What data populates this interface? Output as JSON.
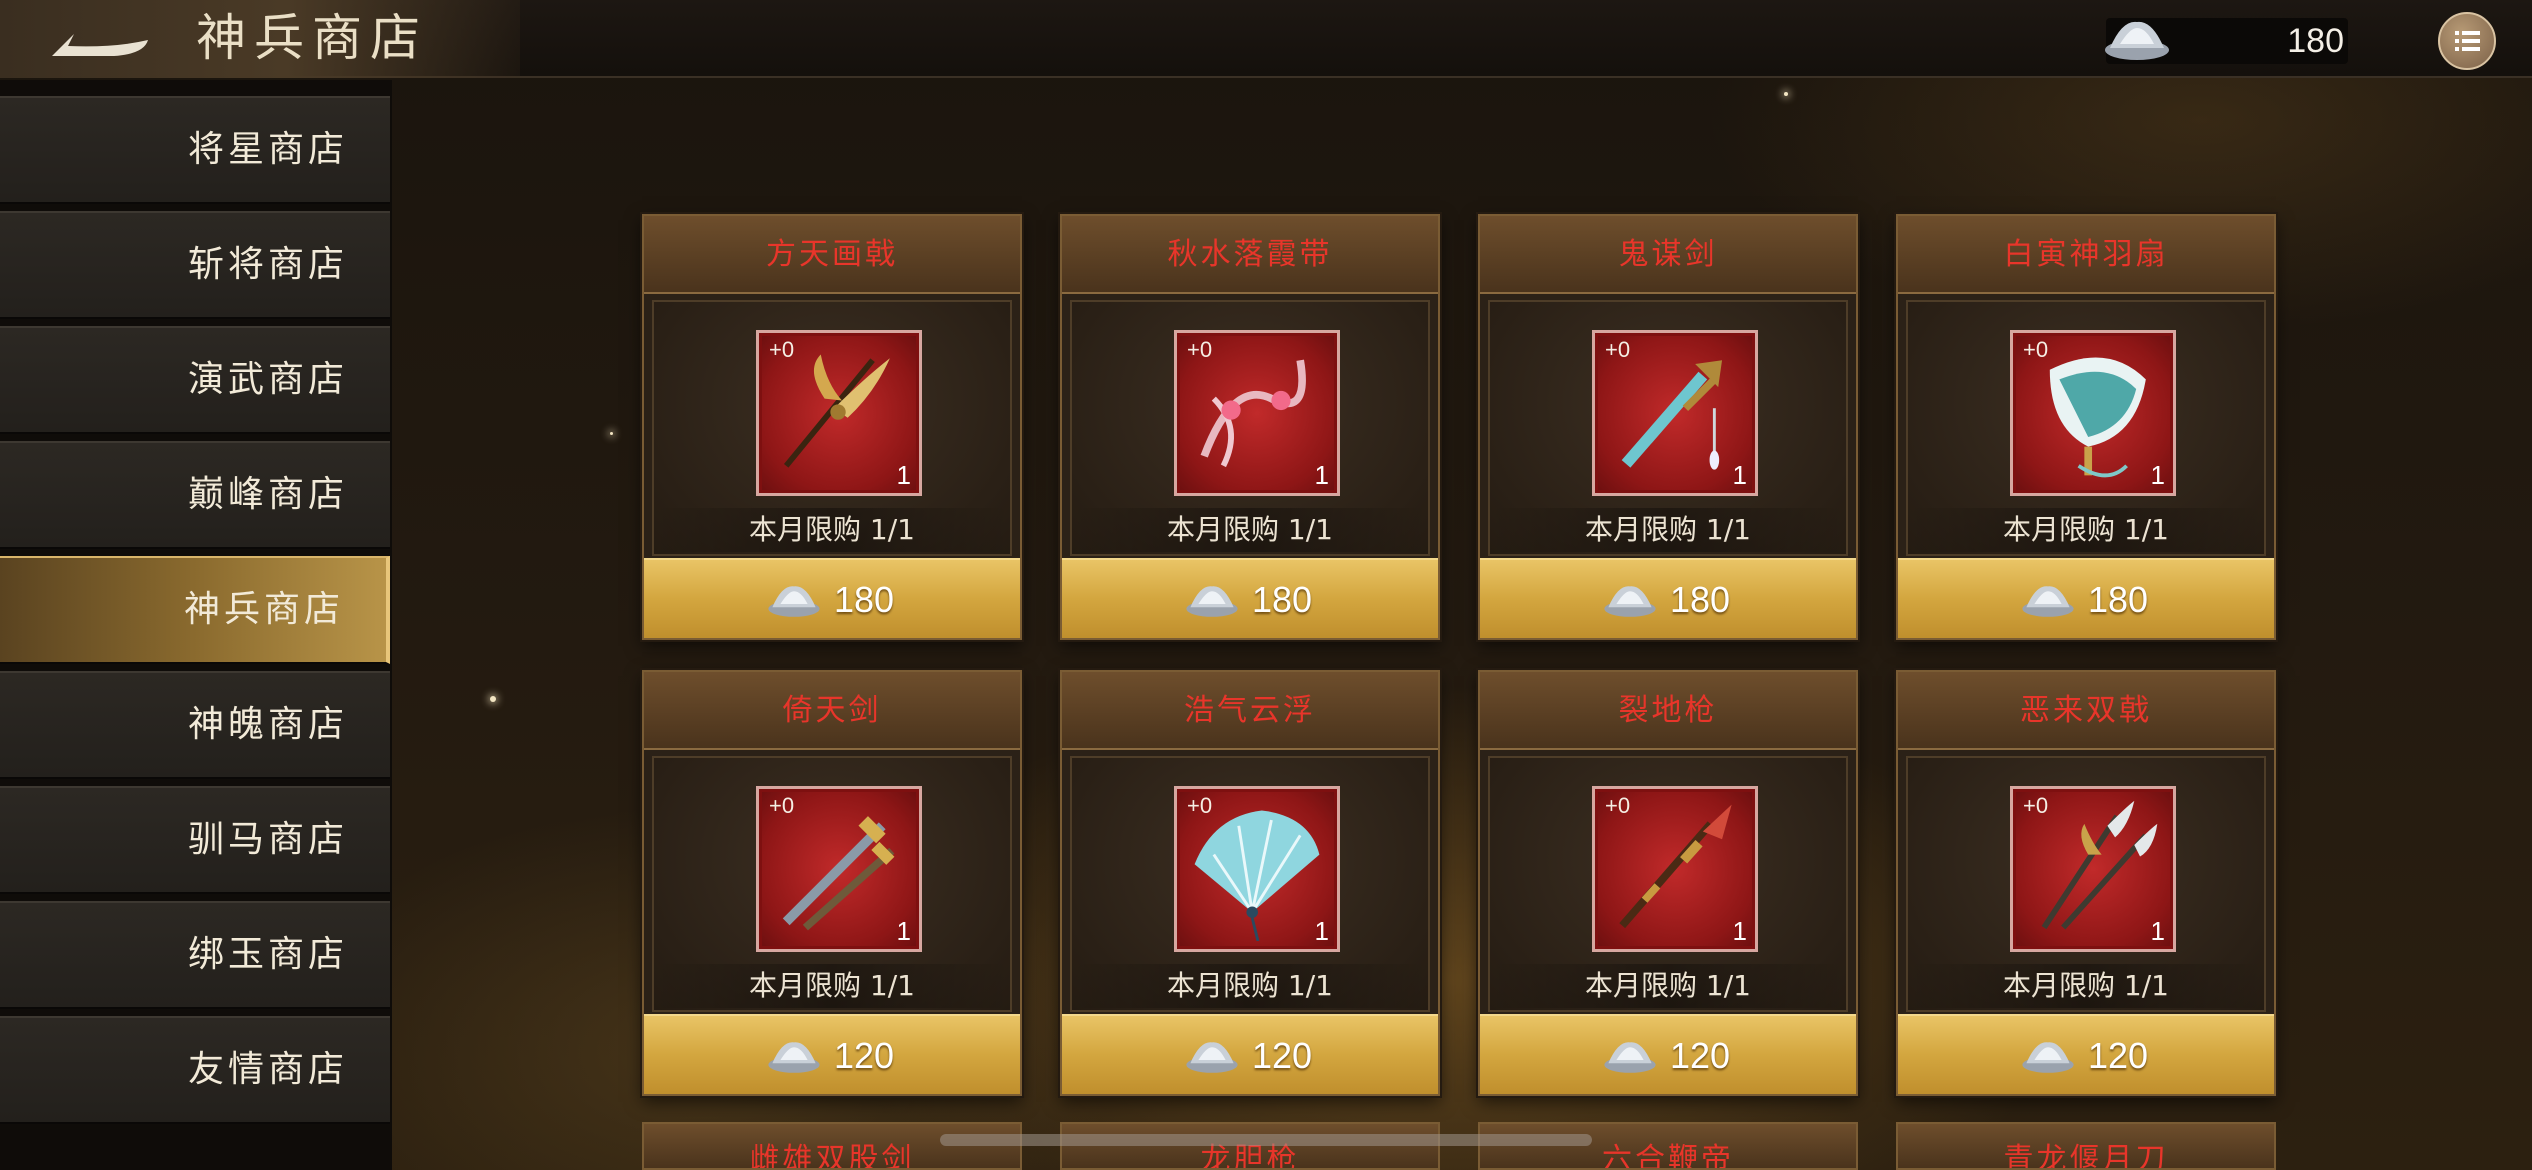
{
  "header": {
    "title": "神兵商店",
    "currency_icon": "silver-ingot-icon",
    "currency_amount": "180",
    "menu_icon": "list-menu-icon",
    "back_icon": "back-arrow-icon"
  },
  "sidebar": {
    "items": [
      {
        "label": "将星商店",
        "active": false
      },
      {
        "label": "斩将商店",
        "active": false
      },
      {
        "label": "演武商店",
        "active": false
      },
      {
        "label": "巅峰商店",
        "active": false
      },
      {
        "label": "神兵商店",
        "active": true
      },
      {
        "label": "神魄商店",
        "active": false
      },
      {
        "label": "驯马商店",
        "active": false
      },
      {
        "label": "绑玉商店",
        "active": false
      },
      {
        "label": "友情商店",
        "active": false
      }
    ]
  },
  "shop": {
    "items": [
      {
        "name": "方天画戟",
        "level": "+0",
        "qty": "1",
        "limit": "本月限购 1/1",
        "price": "180",
        "icon": "halberd-icon"
      },
      {
        "name": "秋水落霞带",
        "level": "+0",
        "qty": "1",
        "limit": "本月限购 1/1",
        "price": "180",
        "icon": "ribbon-sash-icon"
      },
      {
        "name": "鬼谋剑",
        "level": "+0",
        "qty": "1",
        "limit": "本月限购 1/1",
        "price": "180",
        "icon": "sword-icon"
      },
      {
        "name": "白寅神羽扇",
        "level": "+0",
        "qty": "1",
        "limit": "本月限购 1/1",
        "price": "180",
        "icon": "feather-fan-icon"
      },
      {
        "name": "倚天剑",
        "level": "+0",
        "qty": "1",
        "limit": "本月限购 1/1",
        "price": "120",
        "icon": "twin-swords-icon"
      },
      {
        "name": "浩气云浮",
        "level": "+0",
        "qty": "1",
        "limit": "本月限购 1/1",
        "price": "120",
        "icon": "folding-fan-icon"
      },
      {
        "name": "裂地枪",
        "level": "+0",
        "qty": "1",
        "limit": "本月限购 1/1",
        "price": "120",
        "icon": "spear-icon"
      },
      {
        "name": "恶来双戟",
        "level": "+0",
        "qty": "1",
        "limit": "本月限购 1/1",
        "price": "120",
        "icon": "double-halberd-icon"
      }
    ],
    "next_row": [
      {
        "name": "雌雄双股剑"
      },
      {
        "name": "龙胆枪"
      },
      {
        "name": "六合鞭帝"
      },
      {
        "name": "青龙偃月刀"
      }
    ]
  },
  "colors": {
    "item_name": "#e8352a",
    "price_bar": "#d3a63f",
    "active_tab": "#b89448"
  }
}
